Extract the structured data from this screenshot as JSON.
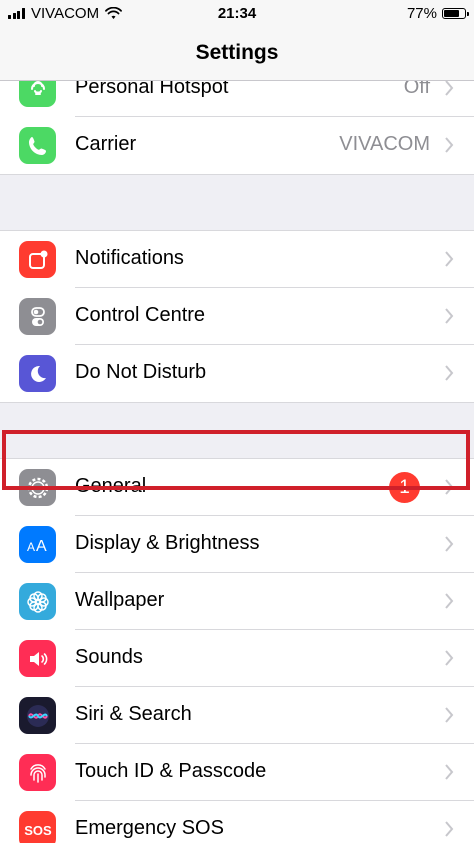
{
  "status_bar": {
    "carrier": "VIVACOM",
    "time": "21:34",
    "battery_percent": "77%",
    "battery_level": 0.77
  },
  "nav": {
    "title": "Settings"
  },
  "groups": [
    [
      {
        "label": "Personal Hotspot",
        "value": "Off",
        "icon": "hotspot-icon",
        "color": "#4cd964"
      },
      {
        "label": "Carrier",
        "value": "VIVACOM",
        "icon": "phone-icon",
        "color": "#4cd964"
      }
    ],
    [
      {
        "label": "Notifications",
        "icon": "notifications-icon",
        "color": "#ff3b30"
      },
      {
        "label": "Control Centre",
        "icon": "toggles-icon",
        "color": "#8e8e93"
      },
      {
        "label": "Do Not Disturb",
        "icon": "moon-icon",
        "color": "#5856d6"
      }
    ],
    [
      {
        "label": "General",
        "badge": "1",
        "icon": "gear-icon",
        "color": "#8e8e93",
        "highlighted": true
      },
      {
        "label": "Display & Brightness",
        "icon": "display-aa-icon",
        "color": "#007aff"
      },
      {
        "label": "Wallpaper",
        "icon": "flower-icon",
        "color": "#34aadc"
      },
      {
        "label": "Sounds",
        "icon": "speaker-icon",
        "color": "#ff2d55"
      },
      {
        "label": "Siri & Search",
        "icon": "siri-icon",
        "color": "#1a1a2e"
      },
      {
        "label": "Touch ID & Passcode",
        "icon": "fingerprint-icon",
        "color": "#ff2d55"
      },
      {
        "label": "Emergency SOS",
        "icon": "sos-icon",
        "color": "#ff3b30"
      }
    ]
  ]
}
